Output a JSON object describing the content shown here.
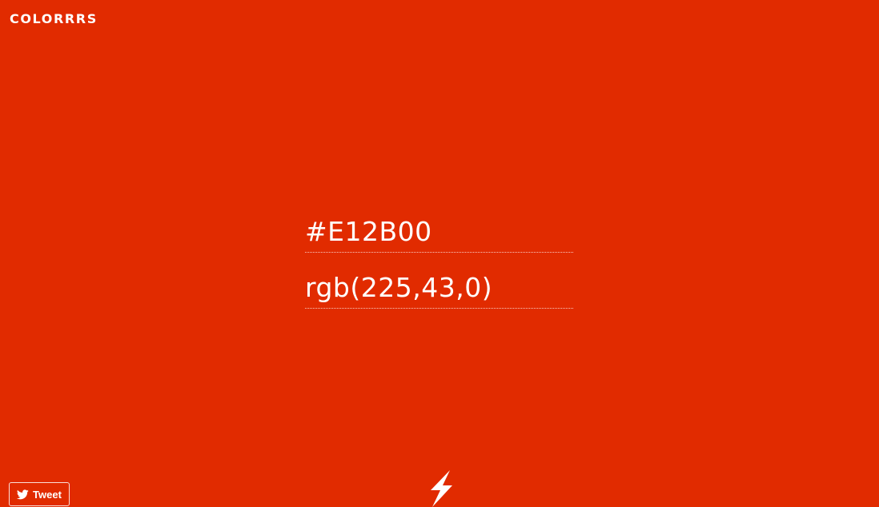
{
  "app": {
    "logo_text": "COLORRRS",
    "background_color": "#E12B00",
    "text_color": "#FFFFFF"
  },
  "color": {
    "hex_value": "#E12B00",
    "rgb_value": "rgb(225,43,0)"
  },
  "footer": {
    "tweet_label": "Tweet",
    "tweet_icon": "twitter-bird-icon",
    "randomize_icon": "lightning-bolt-icon"
  }
}
